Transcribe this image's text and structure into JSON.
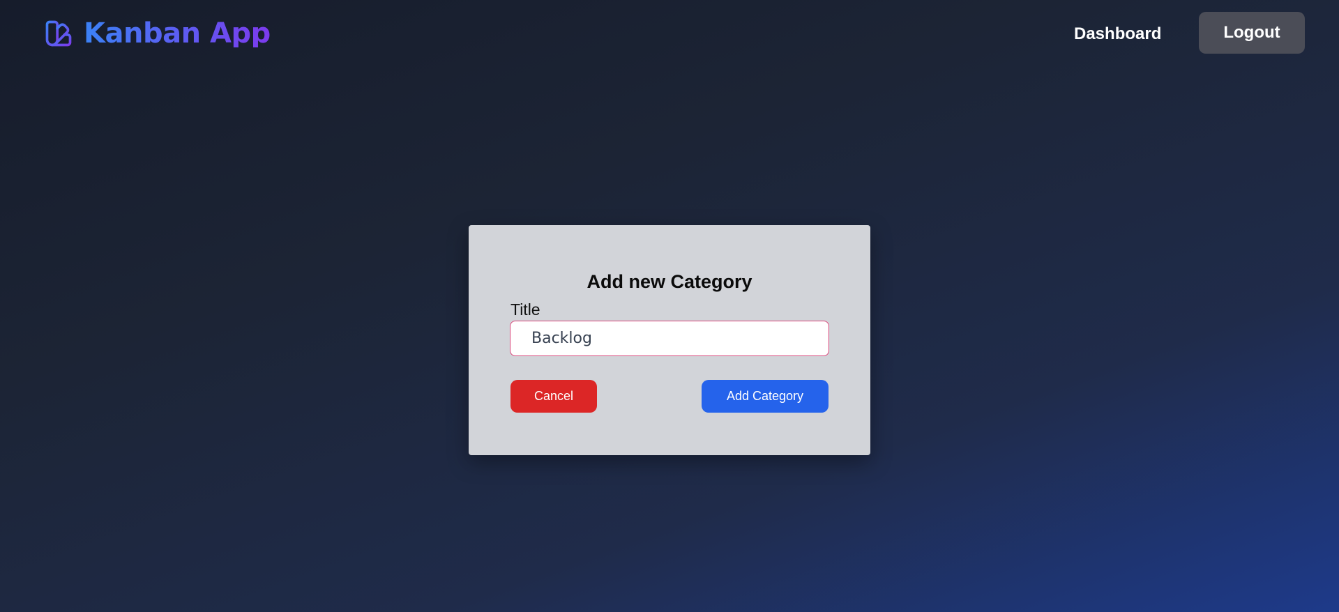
{
  "navbar": {
    "brand": {
      "text": "Kanban App",
      "icon": "swatch-book-icon"
    },
    "links": {
      "dashboard": "Dashboard",
      "logout": "Logout"
    }
  },
  "modal": {
    "title": "Add new Category",
    "field_label": "Title",
    "title_input": {
      "value": "Backlog",
      "placeholder": ""
    },
    "buttons": {
      "cancel": "Cancel",
      "add": "Add Category"
    }
  },
  "colors": {
    "brand_gradient_start": "#3b82f6",
    "brand_gradient_end": "#7c3aed",
    "cancel_button": "#dc2626",
    "add_button": "#2563eb",
    "logout_button": "#4b4d57",
    "modal_background": "#d2d4d9",
    "input_focus_border": "#d9467a"
  }
}
